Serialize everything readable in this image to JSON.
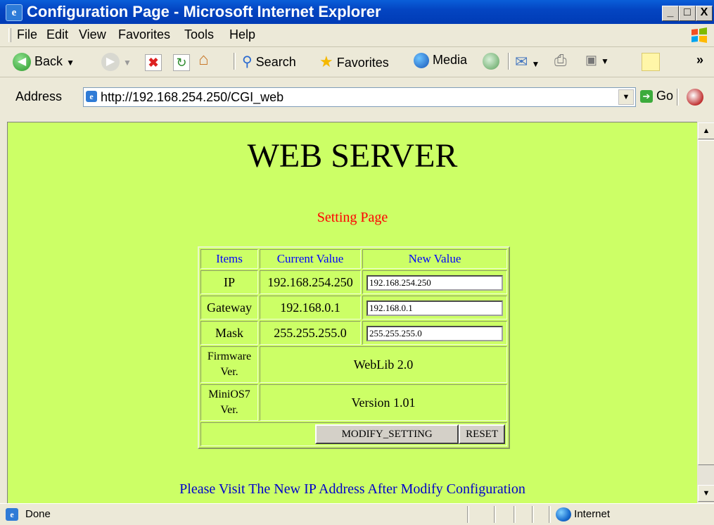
{
  "window": {
    "title": "Configuration Page - Microsoft Internet Explorer",
    "controls": {
      "minimize": "_",
      "maximize": "□",
      "close": "X"
    }
  },
  "menu": [
    "File",
    "Edit",
    "View",
    "Favorites",
    "Tools",
    "Help"
  ],
  "toolbar": {
    "back": "Back",
    "search": "Search",
    "favorites": "Favorites",
    "media": "Media"
  },
  "address": {
    "label": "Address",
    "url": "http://192.168.254.250/CGI_web",
    "go": "Go"
  },
  "page": {
    "heading": "WEB SERVER",
    "subheading": "Setting Page",
    "table": {
      "headers": [
        "Items",
        "Current Value",
        "New Value"
      ],
      "rows": [
        {
          "item": "IP",
          "current": "192.168.254.250",
          "new": "192.168.254.250"
        },
        {
          "item": "Gateway",
          "current": "192.168.0.1",
          "new": "192.168.0.1"
        },
        {
          "item": "Mask",
          "current": "255.255.255.0",
          "new": "255.255.255.0"
        }
      ],
      "firmware": {
        "label_line1": "Firmware",
        "label_line2": "Ver.",
        "value": "WebLib 2.0"
      },
      "minios": {
        "label_line1": "MiniOS7",
        "label_line2": "Ver.",
        "value": "Version 1.01"
      },
      "modify_button": "MODIFY_SETTING",
      "reset_button": "RESET"
    },
    "notice": "Please Visit The New IP Address After Modify Configuration"
  },
  "status": {
    "text": "Done",
    "zone": "Internet"
  },
  "colors": {
    "page_bg": "#ccff66",
    "subheading": "#ff0000",
    "header_text": "#0000ff",
    "notice": "#0000cc"
  }
}
